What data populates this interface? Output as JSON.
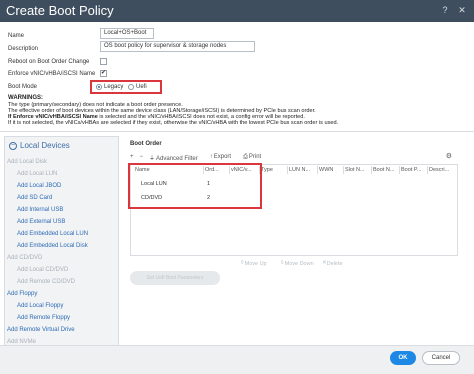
{
  "window": {
    "title": "Create Boot Policy",
    "help_icon": "help-icon",
    "close_icon": "close-icon"
  },
  "form": {
    "name_label": "Name",
    "name_value": "Local+OS+Boot",
    "desc_label": "Description",
    "desc_value": "OS boot policy for supervisor & storage nodes",
    "reboot_label": "Reboot on Boot Order Change",
    "reboot_checked": false,
    "enforce_label": "Enforce vNIC/vHBA/iSCSI Name",
    "enforce_checked": true,
    "boot_mode_label": "Boot Mode",
    "boot_mode_options": [
      "Legacy",
      "Uefi"
    ],
    "boot_mode_selected": "Legacy"
  },
  "warnings": {
    "title": "WARNINGS:",
    "line1": "The type (primary/secondary) does not indicate a boot order presence.",
    "line2": "The effective order of boot devices within the same device class (LAN/Storage/iSCSI) is determined by PCIe bus scan order.",
    "line3_bold": "If Enforce vNIC/vHBA/iSCSI Name",
    "line3_rest": " is selected and the vNIC/vHBA/iSCSI does not exist, a config error will be reported.",
    "line4": "If it is not selected, the vNICs/vHBAs are selected if they exist, otherwise the vNIC/vHBA with the lowest PCIe bus scan order is used."
  },
  "left_panel": {
    "title": "Local Devices",
    "items": [
      {
        "label": "Add Local Disk",
        "enabled": false,
        "indent": 0
      },
      {
        "label": "Add Local LUN",
        "enabled": false,
        "indent": 1
      },
      {
        "label": "Add Local JBOD",
        "enabled": true,
        "indent": 1
      },
      {
        "label": "Add SD Card",
        "enabled": true,
        "indent": 1
      },
      {
        "label": "Add Internal USB",
        "enabled": true,
        "indent": 1
      },
      {
        "label": "Add External USB",
        "enabled": true,
        "indent": 1
      },
      {
        "label": "Add Embedded Local LUN",
        "enabled": true,
        "indent": 1
      },
      {
        "label": "Add Embedded Local Disk",
        "enabled": true,
        "indent": 1
      },
      {
        "label": "Add CD/DVD",
        "enabled": false,
        "indent": 0
      },
      {
        "label": "Add Local CD/DVD",
        "enabled": false,
        "indent": 1
      },
      {
        "label": "Add Remote CD/DVD",
        "enabled": false,
        "indent": 1
      },
      {
        "label": "Add Floppy",
        "enabled": true,
        "indent": 0
      },
      {
        "label": "Add Local Floppy",
        "enabled": true,
        "indent": 1
      },
      {
        "label": "Add Remote Floppy",
        "enabled": true,
        "indent": 1
      },
      {
        "label": "Add Remote Virtual Drive",
        "enabled": true,
        "indent": 0
      },
      {
        "label": "Add NVMe",
        "enabled": false,
        "indent": 0
      }
    ]
  },
  "boot_order": {
    "title": "Boot Order",
    "toolbar": {
      "add": "+",
      "remove": "−",
      "filter": "Advanced Filter",
      "export": "Export",
      "print": "Print"
    },
    "columns": [
      "Name",
      "Ord...",
      "vNIC/v...",
      "Type",
      "LUN N...",
      "WWN",
      "Slot N...",
      "Boot N...",
      "Boot P...",
      "Descri..."
    ],
    "rows": [
      {
        "name": "Local LUN",
        "order": "1"
      },
      {
        "name": "CD/DVD",
        "order": "2"
      }
    ],
    "actions": {
      "move_up": "Move Up",
      "move_down": "Move Down",
      "delete": "Delete"
    },
    "set_button": "Set Uefi Boot Parameters"
  },
  "footer": {
    "ok": "OK",
    "cancel": "Cancel"
  }
}
